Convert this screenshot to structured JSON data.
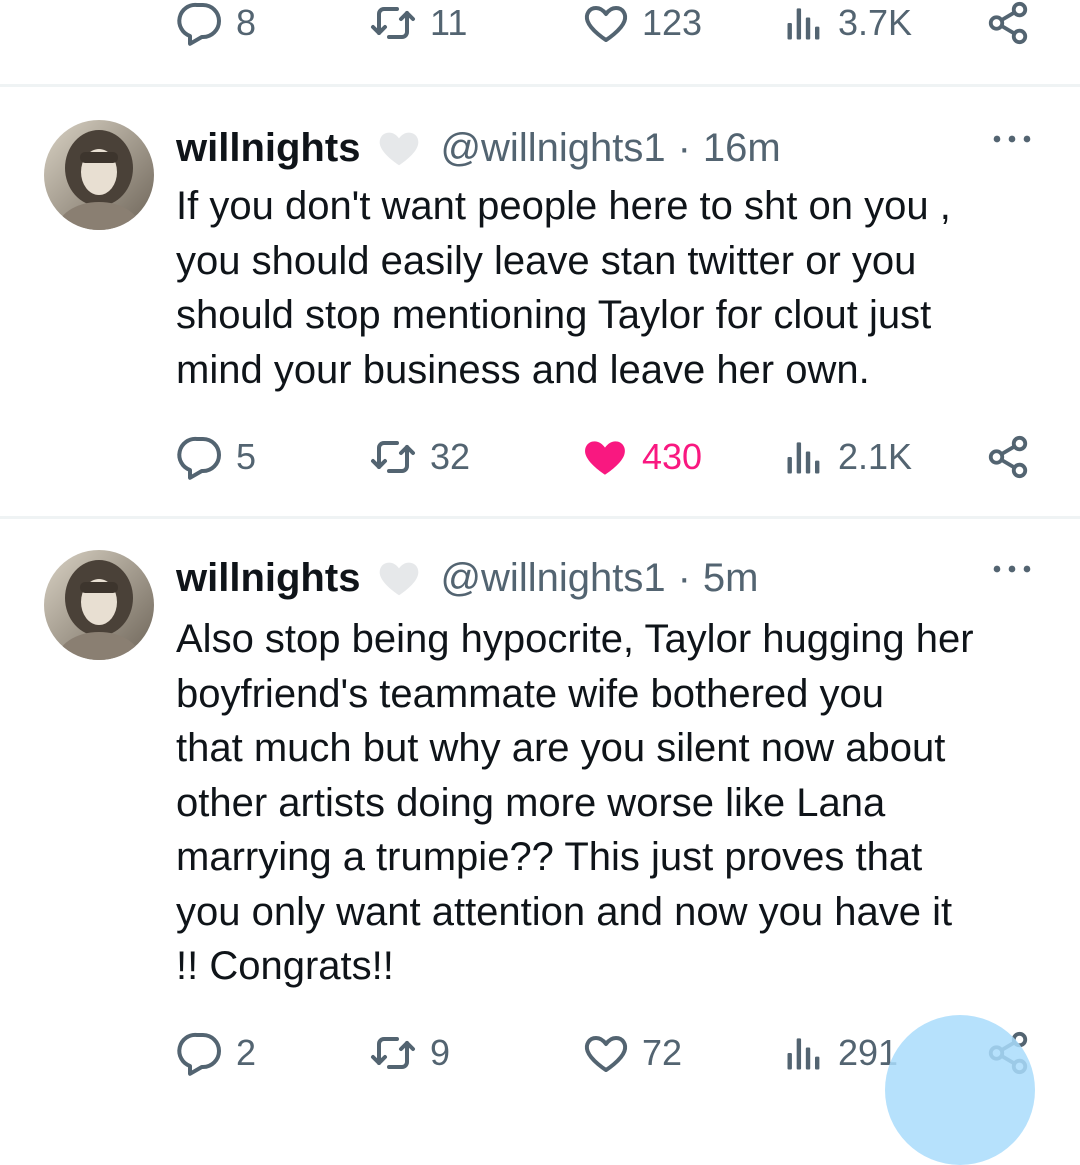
{
  "top_actions": {
    "reply_count": "8",
    "retweet_count": "11",
    "like_count": "123",
    "view_count": "3.7K"
  },
  "tweets": [
    {
      "display_name": "willnights",
      "handle": "@willnights1",
      "separator": "·",
      "time": "16m",
      "text": "If you don't want people here to sht on you ,\nyou should easily leave stan twitter or you\nshould stop mentioning Taylor for clout just\nmind your business and leave her own.",
      "reply_count": "5",
      "retweet_count": "32",
      "like_count": "430",
      "liked": true,
      "view_count": "2.1K"
    },
    {
      "display_name": "willnights",
      "handle": "@willnights1",
      "separator": "·",
      "time": "5m",
      "text": "Also stop being hypocrite, Taylor hugging her\nboyfriend's teammate wife bothered you\nthat much but why are you silent now about\nother artists doing more worse like Lana\nmarrying a trumpie?? This just proves that\nyou only want attention and now you have it\n!! Congrats!!",
      "reply_count": "2",
      "retweet_count": "9",
      "like_count": "72",
      "liked": false,
      "view_count": "291"
    }
  ],
  "colors": {
    "text": "#0f1419",
    "muted": "#536471",
    "like_active": "#f91880",
    "divider": "#eff3f4",
    "fab": "#a9dcfb"
  }
}
